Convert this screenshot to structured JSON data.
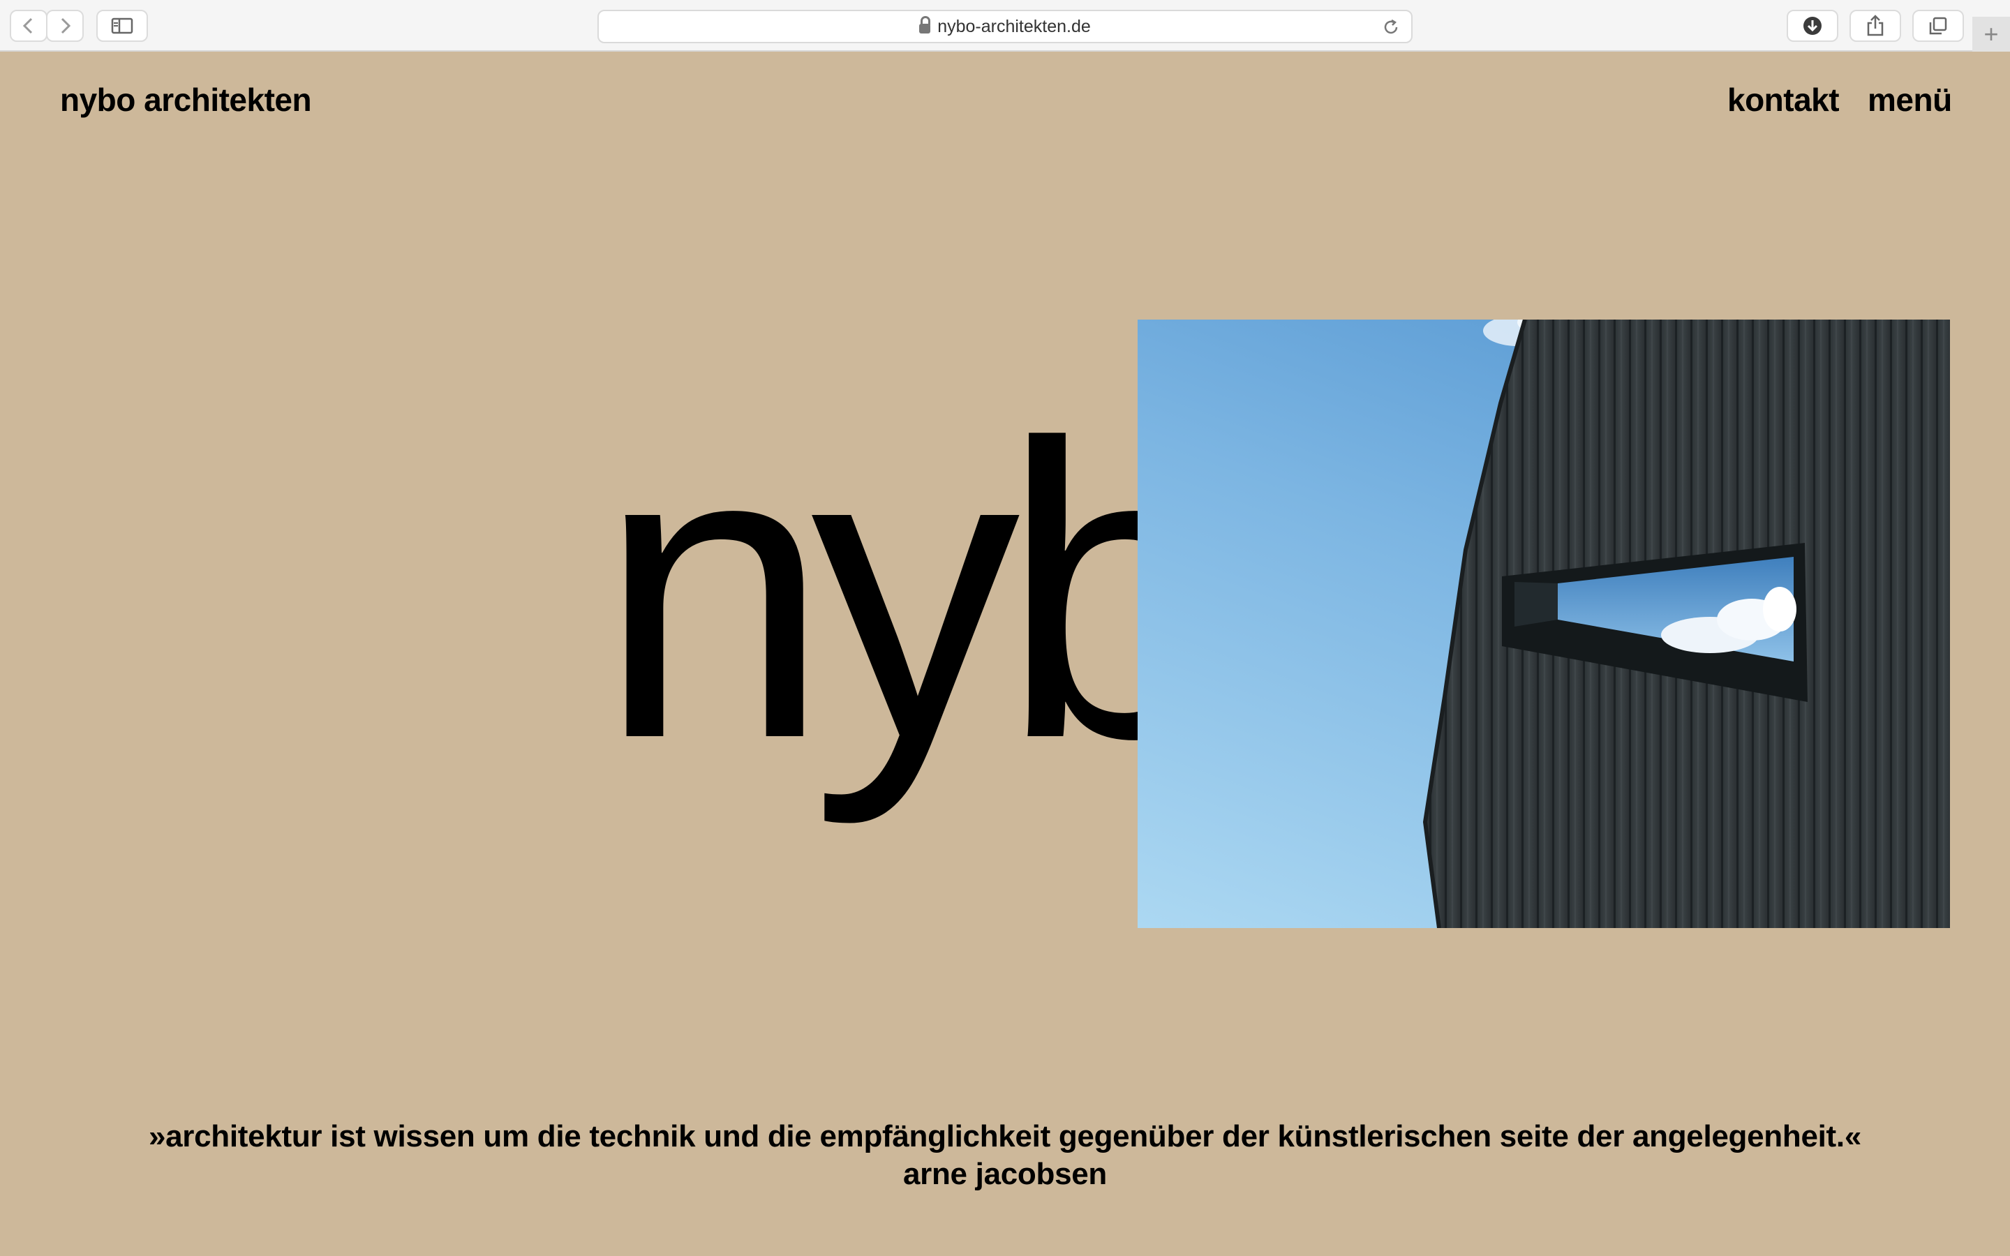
{
  "browser": {
    "url": "nybo-architekten.de",
    "icons": [
      "back-icon",
      "forward-icon",
      "sidebar-icon",
      "lock-icon",
      "reload-icon",
      "download-icon",
      "share-icon",
      "tabs-icon",
      "plus-icon"
    ]
  },
  "header": {
    "logo": "nybo architekten",
    "nav": [
      "kontakt",
      "menü"
    ]
  },
  "hero": {
    "word": "nybo"
  },
  "quote": {
    "text": "»architektur ist wissen um die technik und die empfänglichkeit gegenüber der künstlerischen seite der angelegenheit.«",
    "author": "arne jacobsen"
  },
  "colors": {
    "background": "#cdb89a",
    "text": "#000000",
    "sky": "#7cb5e2",
    "facade": "#33383b"
  }
}
